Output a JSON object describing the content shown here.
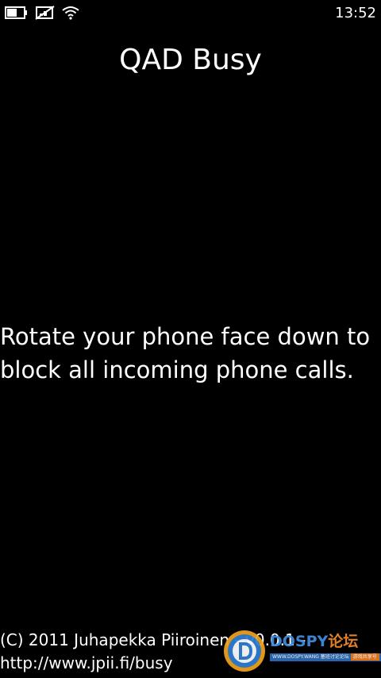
{
  "status_bar": {
    "icons": [
      "battery-icon",
      "signal-off-icon",
      "wifi-icon"
    ],
    "time": "13:52"
  },
  "app": {
    "title": "QAD Busy",
    "instructions": "Rotate your phone face down to block all incoming phone calls.",
    "footer": {
      "line1": "(C) 2011 Juhapekka Piiroinen - v0.0.1 -",
      "line2": "http://www.jpii.fi/busy"
    }
  },
  "watermark": {
    "brand_latin": "DOSPY",
    "brand_cn": "论坛",
    "sub_left": "WWW.DOSPY.WANG 塞班讨论论坛",
    "sub_right": "游戏共享号"
  },
  "colors": {
    "background": "#000000",
    "text": "#ffffff",
    "watermark_blue": "#3f8ee0",
    "watermark_orange": "#f0892a"
  }
}
